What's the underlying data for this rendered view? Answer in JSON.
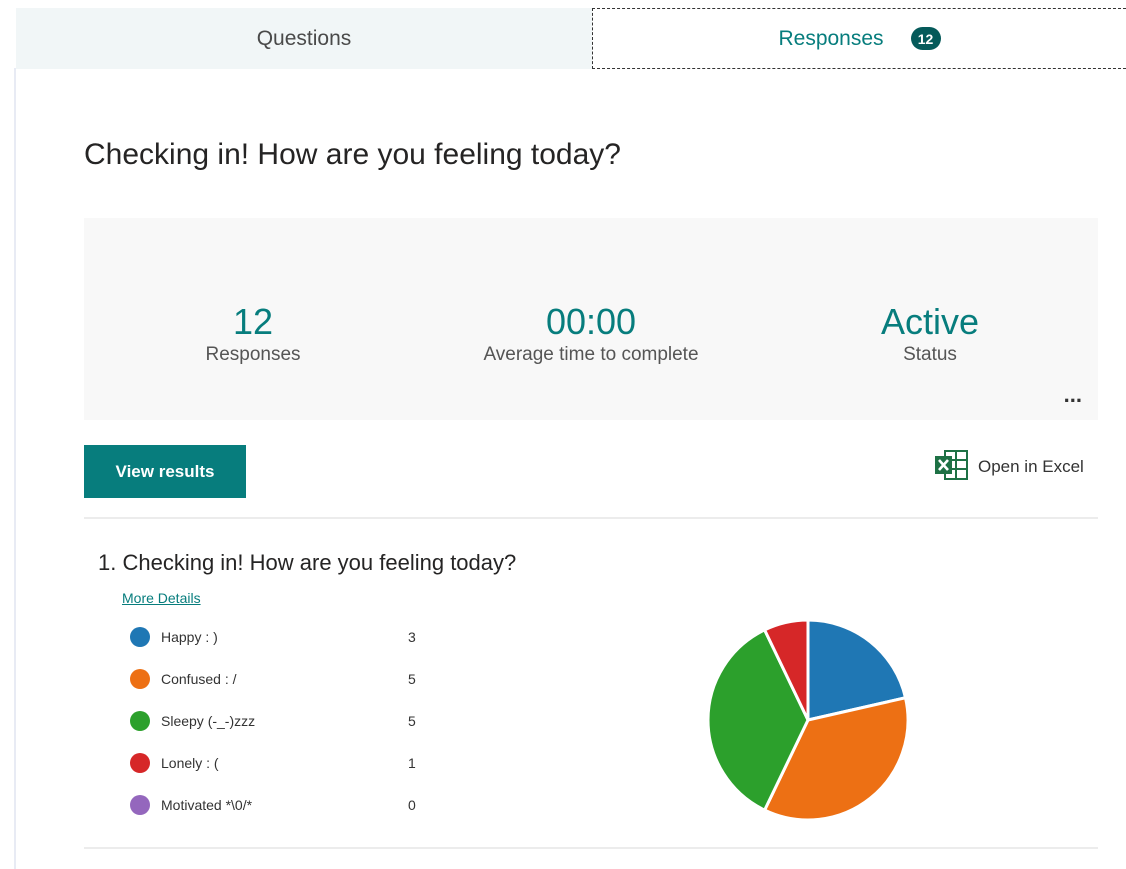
{
  "tabs": {
    "questions_label": "Questions",
    "responses_label": "Responses",
    "responses_badge": "12"
  },
  "form_title": "Checking in! How are you feeling today?",
  "summary": {
    "responses_value": "12",
    "responses_label": "Responses",
    "avg_time_value": "00:00",
    "avg_time_label": "Average time to complete",
    "status_value": "Active",
    "status_label": "Status",
    "more_label": "..."
  },
  "actions": {
    "view_results_label": "View results",
    "open_excel_label": "Open in Excel",
    "excel_icon": "excel-icon"
  },
  "question": {
    "title": "1.  Checking in! How are you feeling today?",
    "more_details_label": "More Details"
  },
  "chart_data": {
    "type": "pie",
    "categories": [
      "Happy : )",
      "Confused : /",
      "Sleepy (-_-)zzz",
      "Lonely : (",
      "Motivated *\\0/*"
    ],
    "values": [
      3,
      5,
      5,
      1,
      0
    ],
    "colors": [
      "#1f77b4",
      "#ed7014",
      "#2ca02c",
      "#d62728",
      "#9467bd"
    ]
  }
}
